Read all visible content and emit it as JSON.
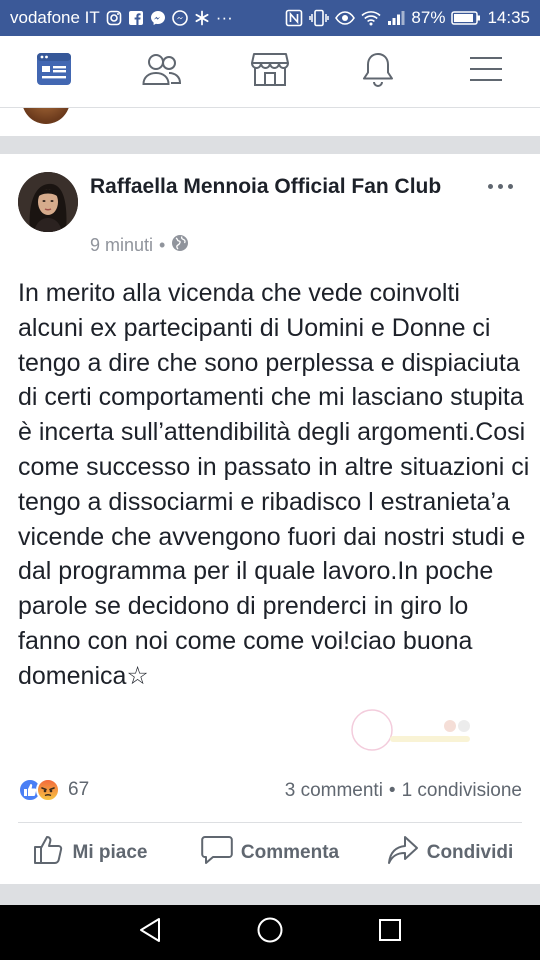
{
  "status_bar": {
    "carrier": "vodafone IT",
    "notif_icons": [
      "instagram-icon",
      "facebook-icon",
      "messenger-icon",
      "messenger-icon",
      "asterisk-icon"
    ],
    "overflow": "···",
    "sys_icons": [
      "nfc-icon",
      "vibrate-icon",
      "eye-icon",
      "wifi-icon",
      "signal-icon"
    ],
    "battery": "87%",
    "time": "14:35"
  },
  "nav": {
    "items": [
      "news-feed-icon",
      "friends-icon",
      "marketplace-icon",
      "notifications-icon",
      "menu-icon"
    ],
    "active_color": "#4267b2"
  },
  "post": {
    "author": "Raffaella Mennoia Official Fan Club",
    "time": "9 minuti",
    "separator": "•",
    "privacy_icon": "globe-icon",
    "text": "In merito alla vicenda che vede coinvolti alcuni ex partecipanti di Uomini e Donne ci tengo a dire che sono perplessa e dispiaciuta di certi comportamenti che mi lasciano stupita è incerta sull’attendibilità degli argomenti.Cosi come successo in passato in altre situazioni ci tengo a dissociarmi e ribadisco l estranieta’a vicende che avvengono fuori dai nostri studi e dal programma per il quale lavoro.In poche parole se decidono di prenderci in giro lo fanno con noi come come voi!ciao buona domenica☆",
    "reactions": {
      "types": [
        "like",
        "angry"
      ],
      "count": "67"
    },
    "comments": "3 commenti",
    "dot": "•",
    "shares": "1 condivisione",
    "actions": {
      "like": "Mi piace",
      "comment": "Commenta",
      "share": "Condividi"
    }
  },
  "colors": {
    "facebook_blue": "#3b5998",
    "text": "#1d2129",
    "muted": "#606770",
    "band": "#dddfe2"
  }
}
